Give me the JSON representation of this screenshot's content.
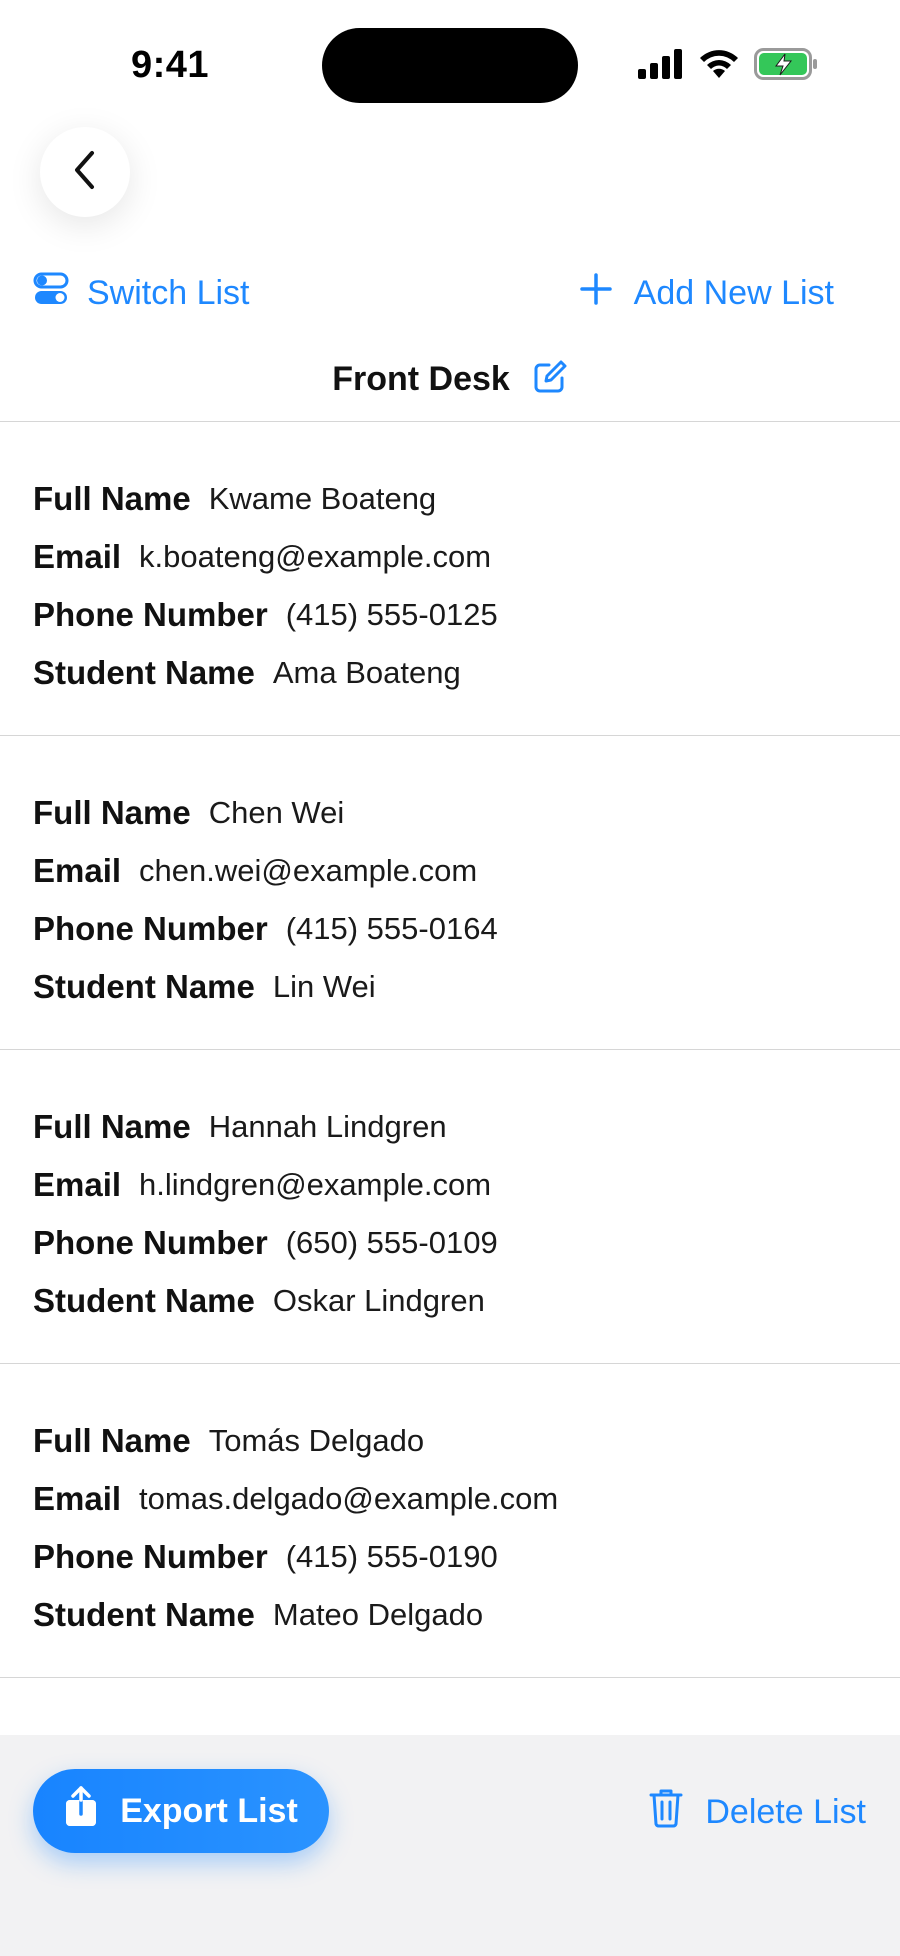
{
  "status_bar": {
    "time": "9:41",
    "icons": [
      "cellular-signal-icon",
      "wifi-icon",
      "battery-charging-icon"
    ]
  },
  "nav": {
    "back_icon": "chevron-left-icon",
    "switch_list_label": "Switch List",
    "switch_list_icon": "toggle-list-icon",
    "add_list_label": "Add New List",
    "add_list_icon": "plus-icon"
  },
  "list": {
    "title": "Front Desk",
    "edit_icon": "edit-icon",
    "labels": {
      "full_name": "Full Name",
      "email": "Email",
      "phone": "Phone Number",
      "student": "Student Name"
    },
    "entries": [
      {
        "full_name": "Kwame Boateng",
        "email": "k.boateng@example.com",
        "phone": "(415) 555-0125",
        "student": "Ama Boateng"
      },
      {
        "full_name": "Chen Wei",
        "email": "chen.wei@example.com",
        "phone": "(415) 555-0164",
        "student": "Lin Wei"
      },
      {
        "full_name": "Hannah Lindgren",
        "email": "h.lindgren@example.com",
        "phone": "(650) 555-0109",
        "student": "Oskar Lindgren"
      },
      {
        "full_name": "Tomás Delgado",
        "email": "tomas.delgado@example.com",
        "phone": "(415) 555-0190",
        "student": "Mateo Delgado"
      }
    ]
  },
  "footer": {
    "export_label": "Export List",
    "export_icon": "share-icon",
    "delete_label": "Delete List",
    "delete_icon": "trash-icon"
  },
  "colors": {
    "accent": "#1e88ff",
    "battery": "#34c759",
    "footer_bg": "#f2f2f3",
    "divider": "#d6d6d6"
  }
}
